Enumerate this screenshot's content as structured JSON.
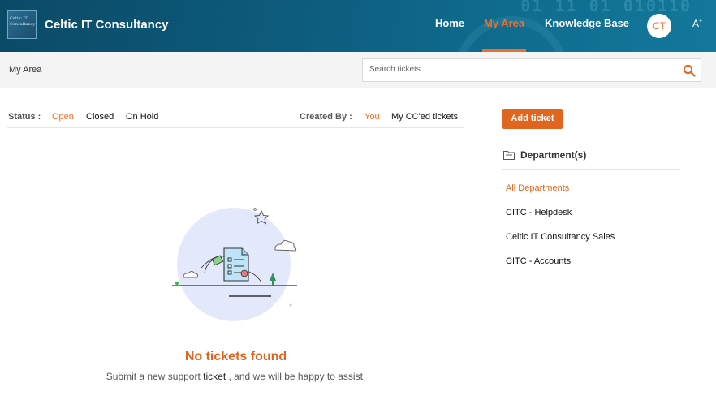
{
  "header": {
    "logo_text": "Celtic IT Consultancy",
    "brand": "Celtic IT Consultancy",
    "nav": [
      "Home",
      "My Area",
      "Knowledge Base"
    ],
    "active_nav": "My Area",
    "avatar_initials": "CT",
    "font_size_label": "A",
    "font_size_sup": "+",
    "decor_binary": "01  11  01  010110"
  },
  "breadcrumb": "My Area",
  "search": {
    "placeholder": "Search tickets",
    "value": ""
  },
  "filters": {
    "status_label": "Status :",
    "status_options": [
      "Open",
      "Closed",
      "On Hold"
    ],
    "status_selected": "Open",
    "created_label": "Created By :",
    "created_options": [
      "You",
      "My CC'ed tickets"
    ],
    "created_selected": "You"
  },
  "empty_state": {
    "title": "No tickets found",
    "subtitle_pre": "Submit a new support",
    "subtitle_link": "ticket",
    "subtitle_post": ", and we will be happy to assist."
  },
  "sidebar": {
    "add_ticket_label": "Add ticket",
    "departments_title": "Department(s)",
    "departments": [
      "All Departments",
      "CITC - Helpdesk",
      "Celtic IT Consultancy Sales",
      "CITC - Accounts"
    ],
    "selected_department": "All Departments"
  },
  "colors": {
    "accent": "#e0651f",
    "header_bg": "#0d5b7c",
    "nav_active": "#ee6e2c"
  }
}
